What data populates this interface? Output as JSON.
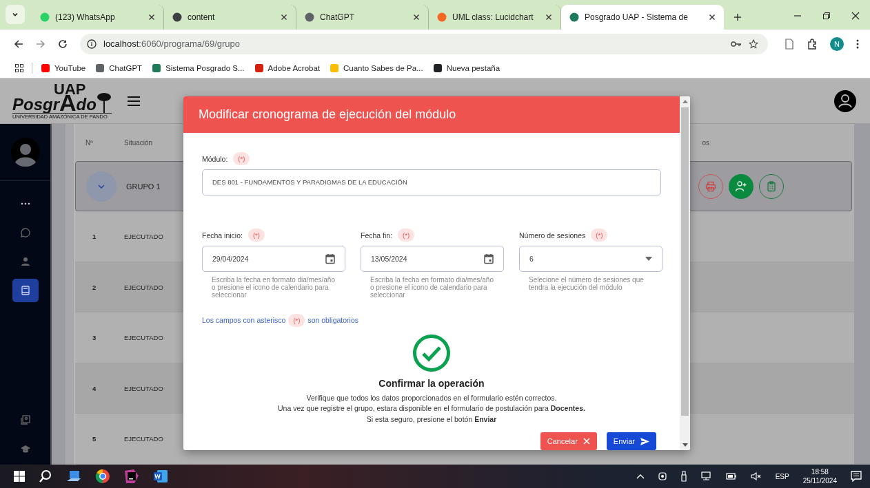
{
  "browser": {
    "tabs": [
      {
        "title": "(123) WhatsApp",
        "selected": false,
        "color": "#25d366"
      },
      {
        "title": "content",
        "selected": false,
        "color": "#3c4043"
      },
      {
        "title": "ChatGPT",
        "selected": false,
        "color": "#5f6368"
      },
      {
        "title": "UML class: Lucidchart",
        "selected": false,
        "color": "#f26722"
      },
      {
        "title": "Posgrado UAP - Sistema de",
        "selected": true,
        "color": "#1f7a5a"
      }
    ],
    "address": {
      "host": "localhost",
      "path": ":6060/programa/69/grupo"
    },
    "profile": "N",
    "bookmarks": [
      {
        "label": "YouTube",
        "color": "#ff0000"
      },
      {
        "label": "ChatGPT",
        "color": "#5f6368"
      },
      {
        "label": "Sistema Posgrado S...",
        "color": "#1f7a5a"
      },
      {
        "label": "Adobe Acrobat",
        "color": "#d4200f"
      },
      {
        "label": "Cuanto Sabes de Pa...",
        "color": "#fbbc04"
      },
      {
        "label": "Nueva pestaña",
        "color": "#202124"
      }
    ]
  },
  "app": {
    "logo": {
      "top": "UAP",
      "main": "Posgr",
      "accent": "A",
      "tail": "do",
      "subtitle": "UNIVERSIDAD AMAZÓNICA DE PANDO"
    },
    "sidebar": {
      "items": [
        {
          "kind": "more",
          "selected": false
        },
        {
          "kind": "chat",
          "selected": false
        },
        {
          "kind": "person",
          "selected": false
        },
        {
          "kind": "book",
          "selected": true
        }
      ],
      "bottom": [
        {
          "kind": "contacts",
          "selected": false
        },
        {
          "kind": "cap",
          "selected": false
        }
      ]
    },
    "table": {
      "columns": [
        "Nº",
        "Situación",
        "os"
      ],
      "group": {
        "label": "GRUPO 1",
        "expanded": true
      },
      "rows": [
        {
          "n": "1",
          "status": "EJECUTADO"
        },
        {
          "n": "2",
          "status": "EJECUTADO"
        },
        {
          "n": "3",
          "status": "EJECUTADO"
        },
        {
          "n": "4",
          "status": "EJECUTADO"
        },
        {
          "n": "5",
          "status": "EJECUTADO"
        }
      ]
    }
  },
  "modal": {
    "title": "Modificar cronograma de ejecución del módulo",
    "module": {
      "label": "Módulo:",
      "required": "(*)",
      "value": "DES 801 - FUNDAMENTOS Y PARADIGMAS DE LA EDUCACIÓN"
    },
    "fields": [
      {
        "kind": "date",
        "label": "Fecha inicio:",
        "required": "(*)",
        "value": "29/04/2024",
        "help": "Escriba la fecha en formato dia/mes/año o presione el icono de calendario para seleccionar"
      },
      {
        "kind": "date",
        "label": "Fecha fin:",
        "required": "(*)",
        "value": "13/05/2024",
        "help": "Escriba la fecha en formato dia/mes/año o presione el icono de calendario para seleccionar"
      },
      {
        "kind": "select",
        "label": "Número de sesiones",
        "required": "(*)",
        "value": "6",
        "help": "Selecione el número de sesiones que tendra la ejecución del módulo"
      }
    ],
    "note": {
      "before": "Los campos con asterisco",
      "badge": "(*)",
      "after": "son obligatorios"
    },
    "confirm": {
      "title": "Confirmar la operación",
      "lines": [
        "Verifique que todos los datos proporcionados en el formulario estén correctos.",
        "Una vez que registre el grupo, estara disponible en el formulario de postulación para **Docentes.**",
        "Si esta seguro, presione el botón **Enviar**"
      ]
    },
    "buttons": [
      {
        "kind": "cancel",
        "label": "Cancelar"
      },
      {
        "kind": "send",
        "label": "Enviar"
      }
    ]
  },
  "taskbar": {
    "language": "ESP",
    "time": "18:58",
    "date": "25/11/2024"
  }
}
